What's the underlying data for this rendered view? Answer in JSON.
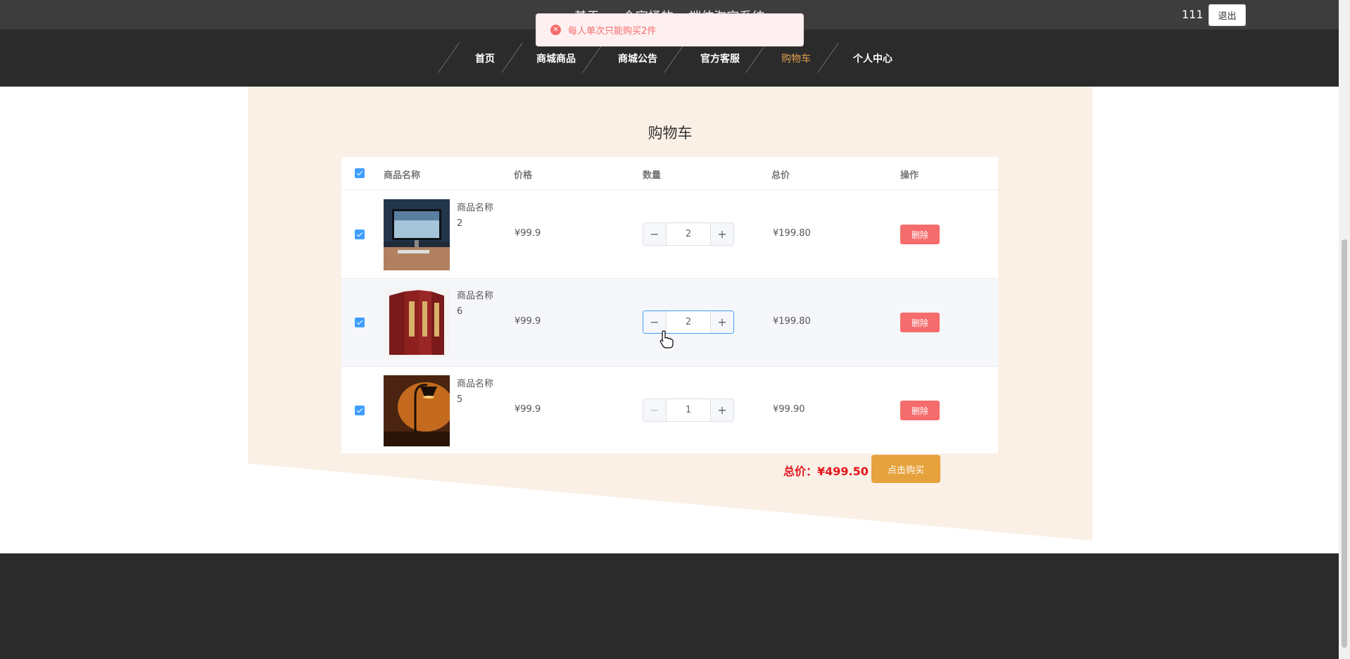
{
  "header": {
    "site_title": "基于vue全家桶的pc端仿淘宝系统",
    "user": "111",
    "logout_label": "退出"
  },
  "nav": {
    "items": [
      {
        "label": "首页",
        "active": false
      },
      {
        "label": "商城商品",
        "active": false
      },
      {
        "label": "商城公告",
        "active": false
      },
      {
        "label": "官方客服",
        "active": false
      },
      {
        "label": "购物车",
        "active": true
      },
      {
        "label": "个人中心",
        "active": false
      }
    ]
  },
  "toast": {
    "type": "error",
    "message": "每人单次只能购买2件"
  },
  "cart": {
    "title": "购物车",
    "columns": [
      "商品名称",
      "价格",
      "数量",
      "总价",
      "操作"
    ],
    "rows": [
      {
        "name": "商品名称2",
        "price": "¥99.9",
        "quantity": "2",
        "subtotal": "¥199.80",
        "action": "删除",
        "checked": true,
        "image": "monitor-desk-photo"
      },
      {
        "name": "商品名称6",
        "price": "¥99.9",
        "quantity": "2",
        "subtotal": "¥199.80",
        "action": "删除",
        "checked": true,
        "image": "red-book-set-photo"
      },
      {
        "name": "商品名称5",
        "price": "¥99.9",
        "quantity": "1",
        "subtotal": "¥99.90",
        "action": "删除",
        "checked": true,
        "image": "desk-lamp-photo"
      }
    ],
    "total_label": "总价：¥499.50",
    "buy_label": "点击购买"
  },
  "colors": {
    "nav_bg": "#2b2b2b",
    "active_nav": "#e0a050",
    "panel_bg": "#fbf0e6",
    "delete_btn": "#f56c6c",
    "buy_btn": "#e6a23c",
    "checkbox": "#409eff",
    "total_text": "#e4161c"
  }
}
